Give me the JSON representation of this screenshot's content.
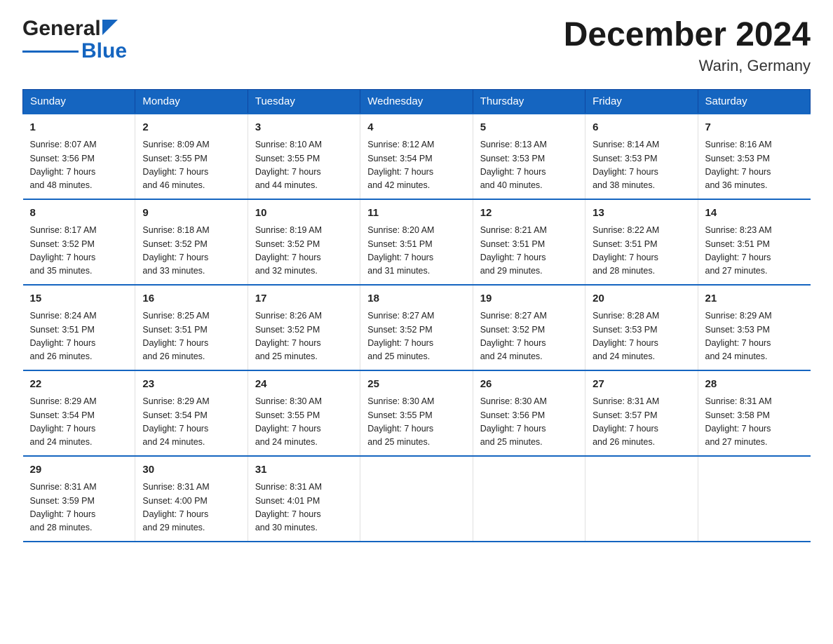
{
  "header": {
    "logo_general": "General",
    "logo_blue": "Blue",
    "title": "December 2024",
    "subtitle": "Warin, Germany"
  },
  "days_of_week": [
    "Sunday",
    "Monday",
    "Tuesday",
    "Wednesday",
    "Thursday",
    "Friday",
    "Saturday"
  ],
  "weeks": [
    [
      {
        "day": "1",
        "sunrise": "8:07 AM",
        "sunset": "3:56 PM",
        "daylight": "7 hours and 48 minutes."
      },
      {
        "day": "2",
        "sunrise": "8:09 AM",
        "sunset": "3:55 PM",
        "daylight": "7 hours and 46 minutes."
      },
      {
        "day": "3",
        "sunrise": "8:10 AM",
        "sunset": "3:55 PM",
        "daylight": "7 hours and 44 minutes."
      },
      {
        "day": "4",
        "sunrise": "8:12 AM",
        "sunset": "3:54 PM",
        "daylight": "7 hours and 42 minutes."
      },
      {
        "day": "5",
        "sunrise": "8:13 AM",
        "sunset": "3:53 PM",
        "daylight": "7 hours and 40 minutes."
      },
      {
        "day": "6",
        "sunrise": "8:14 AM",
        "sunset": "3:53 PM",
        "daylight": "7 hours and 38 minutes."
      },
      {
        "day": "7",
        "sunrise": "8:16 AM",
        "sunset": "3:53 PM",
        "daylight": "7 hours and 36 minutes."
      }
    ],
    [
      {
        "day": "8",
        "sunrise": "8:17 AM",
        "sunset": "3:52 PM",
        "daylight": "7 hours and 35 minutes."
      },
      {
        "day": "9",
        "sunrise": "8:18 AM",
        "sunset": "3:52 PM",
        "daylight": "7 hours and 33 minutes."
      },
      {
        "day": "10",
        "sunrise": "8:19 AM",
        "sunset": "3:52 PM",
        "daylight": "7 hours and 32 minutes."
      },
      {
        "day": "11",
        "sunrise": "8:20 AM",
        "sunset": "3:51 PM",
        "daylight": "7 hours and 31 minutes."
      },
      {
        "day": "12",
        "sunrise": "8:21 AM",
        "sunset": "3:51 PM",
        "daylight": "7 hours and 29 minutes."
      },
      {
        "day": "13",
        "sunrise": "8:22 AM",
        "sunset": "3:51 PM",
        "daylight": "7 hours and 28 minutes."
      },
      {
        "day": "14",
        "sunrise": "8:23 AM",
        "sunset": "3:51 PM",
        "daylight": "7 hours and 27 minutes."
      }
    ],
    [
      {
        "day": "15",
        "sunrise": "8:24 AM",
        "sunset": "3:51 PM",
        "daylight": "7 hours and 26 minutes."
      },
      {
        "day": "16",
        "sunrise": "8:25 AM",
        "sunset": "3:51 PM",
        "daylight": "7 hours and 26 minutes."
      },
      {
        "day": "17",
        "sunrise": "8:26 AM",
        "sunset": "3:52 PM",
        "daylight": "7 hours and 25 minutes."
      },
      {
        "day": "18",
        "sunrise": "8:27 AM",
        "sunset": "3:52 PM",
        "daylight": "7 hours and 25 minutes."
      },
      {
        "day": "19",
        "sunrise": "8:27 AM",
        "sunset": "3:52 PM",
        "daylight": "7 hours and 24 minutes."
      },
      {
        "day": "20",
        "sunrise": "8:28 AM",
        "sunset": "3:53 PM",
        "daylight": "7 hours and 24 minutes."
      },
      {
        "day": "21",
        "sunrise": "8:29 AM",
        "sunset": "3:53 PM",
        "daylight": "7 hours and 24 minutes."
      }
    ],
    [
      {
        "day": "22",
        "sunrise": "8:29 AM",
        "sunset": "3:54 PM",
        "daylight": "7 hours and 24 minutes."
      },
      {
        "day": "23",
        "sunrise": "8:29 AM",
        "sunset": "3:54 PM",
        "daylight": "7 hours and 24 minutes."
      },
      {
        "day": "24",
        "sunrise": "8:30 AM",
        "sunset": "3:55 PM",
        "daylight": "7 hours and 24 minutes."
      },
      {
        "day": "25",
        "sunrise": "8:30 AM",
        "sunset": "3:55 PM",
        "daylight": "7 hours and 25 minutes."
      },
      {
        "day": "26",
        "sunrise": "8:30 AM",
        "sunset": "3:56 PM",
        "daylight": "7 hours and 25 minutes."
      },
      {
        "day": "27",
        "sunrise": "8:31 AM",
        "sunset": "3:57 PM",
        "daylight": "7 hours and 26 minutes."
      },
      {
        "day": "28",
        "sunrise": "8:31 AM",
        "sunset": "3:58 PM",
        "daylight": "7 hours and 27 minutes."
      }
    ],
    [
      {
        "day": "29",
        "sunrise": "8:31 AM",
        "sunset": "3:59 PM",
        "daylight": "7 hours and 28 minutes."
      },
      {
        "day": "30",
        "sunrise": "8:31 AM",
        "sunset": "4:00 PM",
        "daylight": "7 hours and 29 minutes."
      },
      {
        "day": "31",
        "sunrise": "8:31 AM",
        "sunset": "4:01 PM",
        "daylight": "7 hours and 30 minutes."
      },
      null,
      null,
      null,
      null
    ]
  ]
}
